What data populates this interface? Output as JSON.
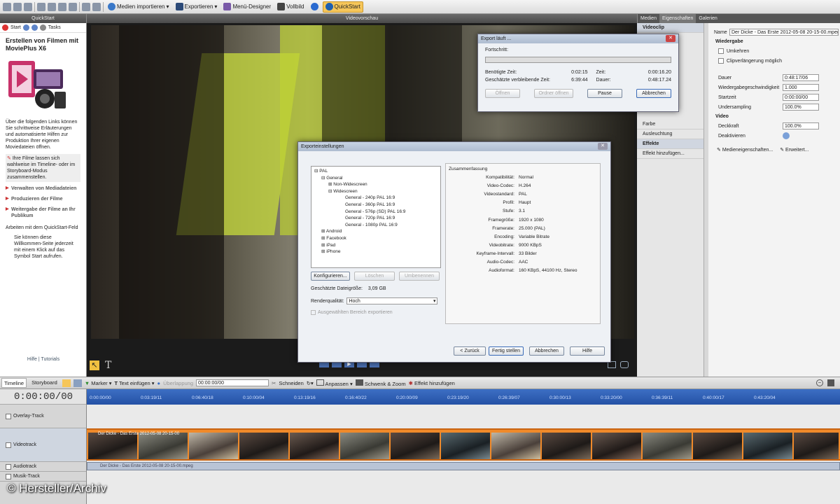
{
  "toolbar": {
    "import_label": "Medien importieren",
    "export_label": "Exportieren",
    "menu_designer_label": "Menü-Designer",
    "fullscreen_label": "Vollbild",
    "quickstart_label": "QuickStart"
  },
  "left_panel": {
    "header": "QuickStart",
    "nav_start": "Start",
    "nav_tasks": "Tasks",
    "title": "Erstellen von Filmen mit MoviePlus X6",
    "intro": "Über die folgenden Links können Sie schrittweise Erläuterungen und automatisierte Hilfen zur Produktion Ihrer eigenen Moviedateien öffnen.",
    "tip": "Ihre Filme lassen sich wahlweise im Timeline- oder im Storyboard-Modus zusammenstellen.",
    "links": [
      "Verwalten von Mediadateien",
      "Produzieren der Filme",
      "Weitergabe der Filme an Ihr Publikum"
    ],
    "section": "Arbeiten mit dem QuickStart-Feld",
    "section_text": "Sie können diese Willkommen-Seite jederzeit mit einem Klick auf das Symbol Start aufrufen.",
    "footer_help": "Hilfe",
    "footer_sep": "|",
    "footer_tutorials": "Tutorials"
  },
  "center": {
    "header": "Videovorschau"
  },
  "right_panel": {
    "tabs": [
      "Medien",
      "Eigenschaften",
      "Galerien"
    ],
    "mid_items": [
      "Videoclip",
      "Farbe",
      "Ausleuchtung",
      "Effekte",
      "Effekt hinzufügen..."
    ],
    "name_label": "Name",
    "name_value": "Der Dicke - Das Erste 2012-05-08 20-15-00.mpeg",
    "section_playback": "Wiedergabe",
    "check_reverse": "Umkehren",
    "check_extend": "Clipverlängerung möglich",
    "duration_label": "Dauer",
    "duration_value": "0:48:17/06",
    "speed_label": "Wiedergabegeschwindigkeit",
    "speed_value": "1.000",
    "start_label": "Startzeit",
    "start_value": "0:00:00/00",
    "undersampling_label": "Undersampling",
    "undersampling_value": "100.0%",
    "section_video": "Video",
    "opacity_label": "Deckkraft",
    "opacity_value": "100.0%",
    "disable_label": "Deaktivieren",
    "media_props": "Medieneigenschaften...",
    "advanced": "Erweitert..."
  },
  "export_progress": {
    "title": "Export läuft ...",
    "progress_label": "Fortschritt:",
    "elapsed_label": "Benötigte Zeit:",
    "elapsed_value": "0:02:15",
    "remaining_label": "Geschätzte verbleibende Zeit:",
    "remaining_value": "6:39:44",
    "time_label": "Zeit:",
    "time_value": "0:00:16.20",
    "duration_label": "Dauer:",
    "duration_value": "0:48:17.24",
    "btn_open": "Öffnen",
    "btn_open_folder": "Ordner öffnen",
    "btn_pause": "Pause",
    "btn_cancel": "Abbrechen"
  },
  "export_settings": {
    "title": "Exporteinstellungen",
    "tree": [
      "PAL",
      "General",
      "Non-Widescreen",
      "Widescreen",
      "General - 240p PAL 16:9",
      "General - 360p PAL 16:9",
      "General - 576p (SD) PAL 16:9",
      "General - 720p PAL 16:9",
      "General - 1080p PAL 16:9",
      "Android",
      "Facebook",
      "iPad",
      "iPhone"
    ],
    "btn_configure": "Konfigurieren...",
    "btn_delete": "Löschen",
    "btn_rename": "Umbenennen",
    "size_label": "Geschätzte Dateigröße:",
    "size_value": "3,09 GB",
    "quality_label": "Renderqualität:",
    "quality_value": "Hoch",
    "export_selection": "Ausgewählten Bereich exportieren",
    "summary_title": "Zusammenfassung",
    "summary": [
      {
        "k": "Kompatibilität:",
        "v": "Normal"
      },
      {
        "k": "Video-Codec:",
        "v": "H.264"
      },
      {
        "k": "Videostandard:",
        "v": "PAL"
      },
      {
        "k": "Profil:",
        "v": "Haupt"
      },
      {
        "k": "Stufe:",
        "v": "3.1"
      },
      {
        "k": "Framegröße:",
        "v": "1920 x 1080"
      },
      {
        "k": "Framerate:",
        "v": "25.000 (PAL)"
      },
      {
        "k": "Encoding:",
        "v": "Variable Bitrate"
      },
      {
        "k": "Videobitrate:",
        "v": "9000 KBpS"
      },
      {
        "k": "Keyframe-Intervall:",
        "v": "33 Bilder"
      },
      {
        "k": "Audio-Codec:",
        "v": "AAC"
      },
      {
        "k": "Audioformat:",
        "v": "160 KBpS, 44100 Hz, Stereo"
      }
    ],
    "btn_back": "< Zurück",
    "btn_finish": "Fertig stellen",
    "btn_cancel": "Abbrechen",
    "btn_help": "Hilfe"
  },
  "timeline": {
    "tab_timeline": "Timeline",
    "tab_storyboard": "Storyboard",
    "marker": "Marker",
    "text_insert": "Text einfügen",
    "overlap": "Überlappung",
    "overlap_value": "00:00:00/00",
    "cut": "Schneiden",
    "adjust": "Anpassen",
    "pan_zoom": "Schwenk & Zoom",
    "add_effect": "Effekt hinzufügen",
    "timecode": "0:00:00/00",
    "tracks": [
      "Overlay-Track",
      "Videotrack",
      "Audiotrack",
      "Musik-Track"
    ],
    "ruler": [
      "0:00:00/00",
      "0:03:19/11",
      "0:06:40/18",
      "0:10:00/04",
      "0:13:19/16",
      "0:16:40/22",
      "0:20:00/09",
      "0:23:19/20",
      "0:26:39/07",
      "0:30:00/13",
      "0:33:20/00",
      "0:36:39/11",
      "0:40:00/17",
      "0:43:20/04"
    ],
    "clip_label": "Der Dicke - Das Erste 2012-05-08 20-15-00",
    "audio_label": "Der Dicke - Das Erste 2012-05-08 20-15-00.mpeg"
  },
  "watermark": "© Hersteller/Archiv"
}
